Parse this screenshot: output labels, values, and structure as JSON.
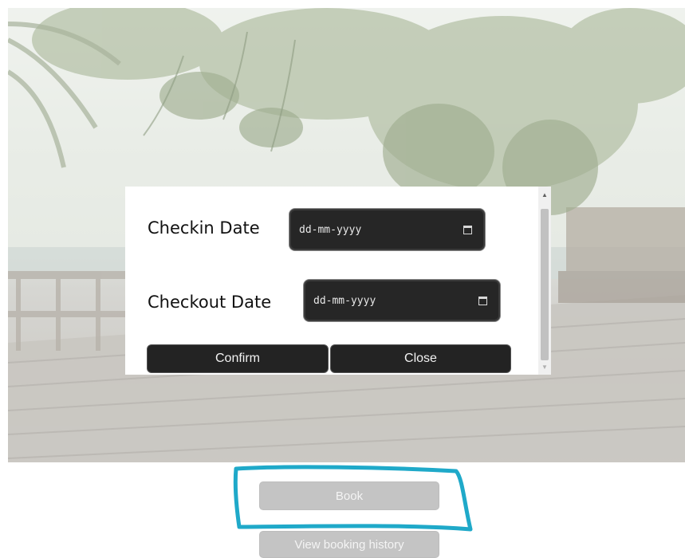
{
  "modal": {
    "checkin_label": "Checkin Date",
    "checkin_placeholder": "dd-mm-yyyy",
    "checkout_label": "Checkout Date",
    "checkout_placeholder": "dd-mm-yyyy",
    "confirm_label": "Confirm",
    "close_label": "Close",
    "calendar_icon": "calendar-icon"
  },
  "page": {
    "book_label": "Book",
    "history_label": "View booking history"
  },
  "colors": {
    "input_bg": "#262626",
    "modal_button_bg": "#232323",
    "page_button_bg": "#c4c4c4",
    "highlight_stroke": "#1fa9c9"
  }
}
